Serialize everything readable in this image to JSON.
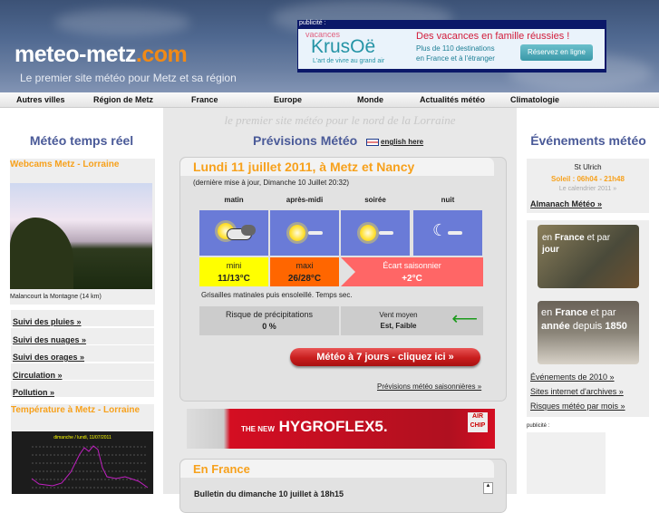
{
  "header": {
    "logo_main": "meteo-metz",
    "logo_tld": ".com",
    "tagline": "Le premier site météo pour Metz et sa région",
    "ad": {
      "label": "publicité :",
      "brand_top": "vacances",
      "brand": "KrusOë",
      "brand_sub": "L'art de vivre au grand air",
      "headline": "Des vacances en famille réussies !",
      "text": "Plus de 110 destinations en France et à l'étranger",
      "cta": "Réservez en ligne"
    }
  },
  "nav": [
    "Autres villes",
    "Région de Metz",
    "France",
    "Europe",
    "Monde",
    "Actualités météo",
    "Climatologie"
  ],
  "left": {
    "title": "Météo temps réel",
    "webcam_title": "Webcams Metz - Lorraine",
    "webcam_caption": "Malancourt la Montagne (14 km)",
    "links": [
      "Suivi des pluies »",
      "Suivi des nuages »",
      "Suivi des orages »",
      "Circulation »",
      "Pollution »"
    ],
    "temp_title": "Température à Metz - Lorraine",
    "temp_chart_title": "dimanche / lundi, 11/07/2011"
  },
  "center": {
    "slogan": "le premier site météo pour le nord de la Lorraine",
    "title": "Prévisions Météo",
    "english_link": "english here",
    "forecast": {
      "heading": "Lundi 11 juillet 2011, à Metz et Nancy",
      "updated": "(dernière mise à jour, Dimanche 10 Juillet 20:32)",
      "periods": [
        {
          "label": "matin",
          "icon": "sun-cloud-icon"
        },
        {
          "label": "après-midi",
          "icon": "sun-icon"
        },
        {
          "label": "soirée",
          "icon": "sun-icon"
        },
        {
          "label": "nuit",
          "icon": "moon-icon"
        }
      ],
      "min_label": "mini",
      "min_value": "11/13°C",
      "max_label": "maxi",
      "max_value": "26/28°C",
      "ecart_label": "Écart saisonnier",
      "ecart_value": "+2°C",
      "description": "Grisailles matinales puis ensoleillé. Temps sec.",
      "precip_label": "Risque de précipitations",
      "precip_value": "0 %",
      "wind_label": "Vent moyen",
      "wind_value": "Est, Faible",
      "button": "Météo à 7 jours - cliquez ici »",
      "seasonal_link": "Prévisions météo saisonnières »"
    },
    "ad": {
      "pre": "THE NEW",
      "brand": "HYGROFLEX5.",
      "badge1": "AIR",
      "badge2": "CHIP"
    },
    "france": {
      "heading": "En France",
      "bulletin": "Bulletin du dimanche 10 juillet à 18h15"
    }
  },
  "right": {
    "title": "Événements météo",
    "saint": "St Ulrich",
    "sun": "Soleil : 06h04 - 21h48",
    "calendar": "Le calendrier 2011 »",
    "almanach": "Almanach Météo »",
    "img1": {
      "a": "en",
      "b": "France",
      "c": "et par",
      "d": "jour"
    },
    "img2": {
      "a": "en",
      "b": "France",
      "c": "et par",
      "d": "année",
      "e": "depuis",
      "f": "1850"
    },
    "links": [
      "Événements de 2010 »",
      "Sites internet d'archives »",
      "Risques météo par mois »"
    ],
    "pub_label": "publicité :"
  },
  "colors": {
    "accent": "#f7a11c",
    "title_blue": "#4a5a98",
    "icon_bg": "#6a7bd7",
    "min": "#ffff00",
    "max": "#ff6600",
    "ecart": "#ff6666",
    "button": "#d42a2a"
  }
}
